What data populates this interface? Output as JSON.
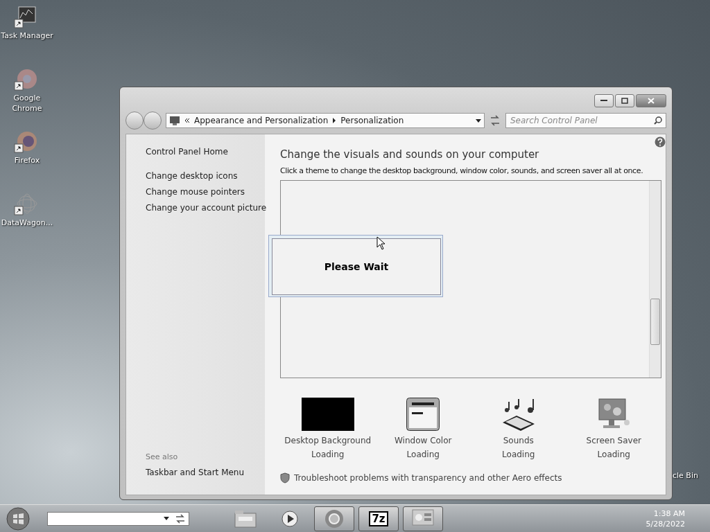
{
  "desktop_icons": [
    {
      "kind": "taskmgr",
      "label": "Task Manager"
    },
    {
      "kind": "chrome",
      "label": "Google Chrome"
    },
    {
      "kind": "firefox",
      "label": "Firefox"
    },
    {
      "kind": "datawagon",
      "label": "DataWagon..."
    }
  ],
  "partial_icon": {
    "label": "cle Bin"
  },
  "window": {
    "address": {
      "crumbs": [
        "Appearance and Personalization",
        "Personalization"
      ]
    },
    "search": {
      "placeholder": "Search Control Panel"
    },
    "sidebar": {
      "home": "Control Panel Home",
      "links": [
        "Change desktop icons",
        "Change mouse pointers",
        "Change your account picture"
      ],
      "see_also": {
        "heading": "See also",
        "links": [
          "Taskbar and Start Menu"
        ]
      }
    },
    "main": {
      "heading": "Change the visuals and sounds on your computer",
      "description": "Click a theme to change the desktop background, window color, sounds, and screen saver all at once.",
      "tiles": [
        {
          "kind": "background",
          "label": "Desktop Background",
          "status": "Loading"
        },
        {
          "kind": "color",
          "label": "Window Color",
          "status": "Loading"
        },
        {
          "kind": "sounds",
          "label": "Sounds",
          "status": "Loading"
        },
        {
          "kind": "saver",
          "label": "Screen Saver",
          "status": "Loading"
        }
      ],
      "troubleshoot": "Troubleshoot problems with transparency and other Aero effects"
    }
  },
  "dialog": {
    "message": "Please Wait"
  },
  "taskbar": {
    "apps": [
      {
        "kind": "explorer",
        "active": false
      },
      {
        "kind": "media",
        "active": false
      },
      {
        "kind": "chrome",
        "active": true
      },
      {
        "kind": "sevenzip",
        "active": true,
        "label": "7z"
      },
      {
        "kind": "panel",
        "active": true
      }
    ],
    "time": "1:38 AM",
    "date": "5/28/2022"
  }
}
